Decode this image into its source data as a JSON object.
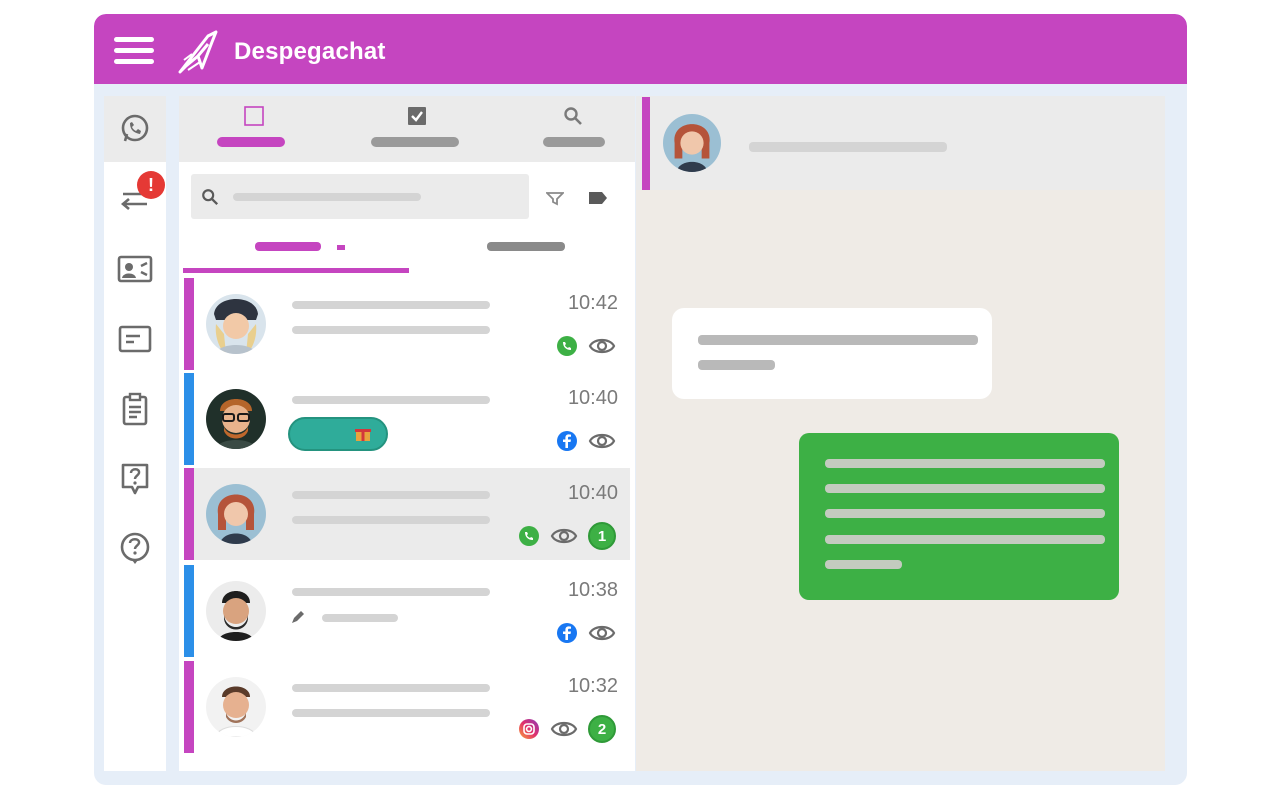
{
  "app": {
    "brand": "Despegachat",
    "accent": "#c545c0"
  },
  "sidebar": {
    "items": [
      {
        "icon": "whatsapp-icon",
        "active": true
      },
      {
        "icon": "transfer-icon",
        "alert": "!"
      },
      {
        "icon": "contact-card-icon"
      },
      {
        "icon": "message-icon"
      },
      {
        "icon": "clipboard-icon"
      },
      {
        "icon": "question-bubble-icon"
      },
      {
        "icon": "help-circle-icon"
      }
    ]
  },
  "tabs": [
    {
      "icon": "checkbox-empty-icon",
      "active": true
    },
    {
      "icon": "checkbox-checked-icon"
    },
    {
      "icon": "search-icon"
    }
  ],
  "conversations": [
    {
      "time": "10:42",
      "channel": "whatsapp-icon",
      "edge": "#c545c0"
    },
    {
      "time": "10:40",
      "channel": "facebook-icon",
      "edge": "#2b8fe8"
    },
    {
      "time": "10:40",
      "channel": "whatsapp-icon",
      "edge": "#c545c0",
      "unread": "1",
      "selected": true
    },
    {
      "time": "10:38",
      "channel": "facebook-icon",
      "edge": "#2b8fe8"
    },
    {
      "time": "10:32",
      "channel": "instagram-icon",
      "edge": "#c545c0",
      "unread": "2"
    }
  ]
}
